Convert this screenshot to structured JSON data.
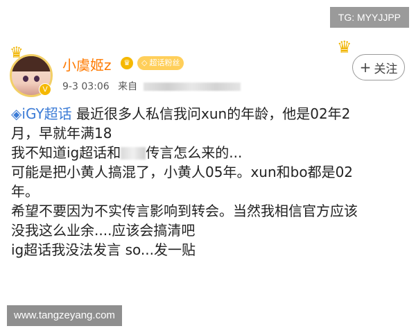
{
  "watermark": {
    "top_right": "TG: MYYJJPP",
    "bottom_left": "www.tangzeyang.com"
  },
  "profile": {
    "username": "小虞姬z",
    "badge_text": "超话粉丝",
    "timestamp": "9-3 03:06",
    "source_prefix": "来自",
    "follow_label": "关注",
    "follow_plus": "+"
  },
  "post": {
    "topic": "iGY超话",
    "line1_after_topic": " 最近很多人私信我问xun的年龄，他是02年2",
    "line2": "月，早就年满18",
    "line3_a": "我不知道ig超话和",
    "line3_b": "传言怎么来的...",
    "line4": "可能是把小黄人搞混了，小黄人05年。xun和bo都是02",
    "line5": "年。",
    "line6": "希望不要因为不实传言影响到转会。当然我相信官方应该",
    "line7": "没我这么业余....应该会搞清吧",
    "line8": "ig超话我没法发言 so...发一贴"
  },
  "icons": [
    "crown-icon",
    "verified-icon",
    "topic-diamond-icon",
    "plus-icon"
  ],
  "colors": {
    "username": "#ff7a00",
    "topic": "#3b7bd6",
    "badge": "#f5b800"
  }
}
